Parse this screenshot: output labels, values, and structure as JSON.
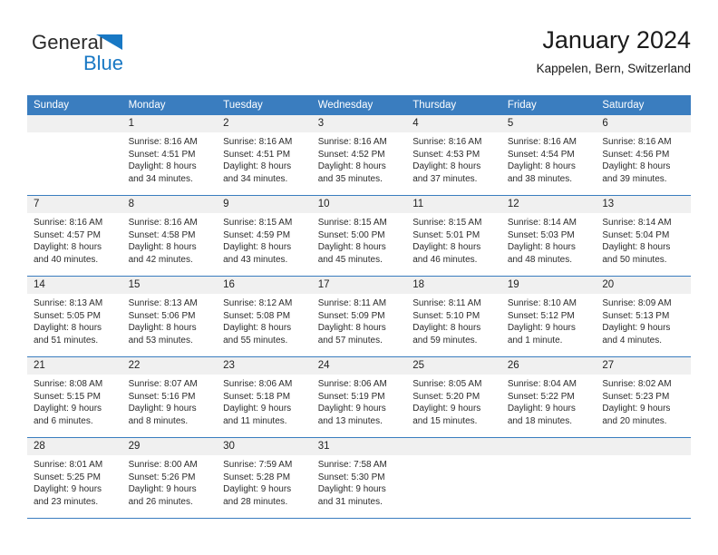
{
  "brand": {
    "name_top": "General",
    "name_bottom": "Blue",
    "accent_color": "#1878c4"
  },
  "header": {
    "title": "January 2024",
    "subtitle": "Kappelen, Bern, Switzerland"
  },
  "colors": {
    "header_row_bg": "#3a7dbf",
    "day_number_bg": "#f0f0f0",
    "text": "#222222",
    "page_bg": "#ffffff"
  },
  "weekday_headers": [
    "Sunday",
    "Monday",
    "Tuesday",
    "Wednesday",
    "Thursday",
    "Friday",
    "Saturday"
  ],
  "weeks": [
    [
      {
        "day": "",
        "sunrise": "",
        "sunset": "",
        "daylight_line1": "",
        "daylight_line2": ""
      },
      {
        "day": "1",
        "sunrise": "Sunrise: 8:16 AM",
        "sunset": "Sunset: 4:51 PM",
        "daylight_line1": "Daylight: 8 hours",
        "daylight_line2": "and 34 minutes."
      },
      {
        "day": "2",
        "sunrise": "Sunrise: 8:16 AM",
        "sunset": "Sunset: 4:51 PM",
        "daylight_line1": "Daylight: 8 hours",
        "daylight_line2": "and 34 minutes."
      },
      {
        "day": "3",
        "sunrise": "Sunrise: 8:16 AM",
        "sunset": "Sunset: 4:52 PM",
        "daylight_line1": "Daylight: 8 hours",
        "daylight_line2": "and 35 minutes."
      },
      {
        "day": "4",
        "sunrise": "Sunrise: 8:16 AM",
        "sunset": "Sunset: 4:53 PM",
        "daylight_line1": "Daylight: 8 hours",
        "daylight_line2": "and 37 minutes."
      },
      {
        "day": "5",
        "sunrise": "Sunrise: 8:16 AM",
        "sunset": "Sunset: 4:54 PM",
        "daylight_line1": "Daylight: 8 hours",
        "daylight_line2": "and 38 minutes."
      },
      {
        "day": "6",
        "sunrise": "Sunrise: 8:16 AM",
        "sunset": "Sunset: 4:56 PM",
        "daylight_line1": "Daylight: 8 hours",
        "daylight_line2": "and 39 minutes."
      }
    ],
    [
      {
        "day": "7",
        "sunrise": "Sunrise: 8:16 AM",
        "sunset": "Sunset: 4:57 PM",
        "daylight_line1": "Daylight: 8 hours",
        "daylight_line2": "and 40 minutes."
      },
      {
        "day": "8",
        "sunrise": "Sunrise: 8:16 AM",
        "sunset": "Sunset: 4:58 PM",
        "daylight_line1": "Daylight: 8 hours",
        "daylight_line2": "and 42 minutes."
      },
      {
        "day": "9",
        "sunrise": "Sunrise: 8:15 AM",
        "sunset": "Sunset: 4:59 PM",
        "daylight_line1": "Daylight: 8 hours",
        "daylight_line2": "and 43 minutes."
      },
      {
        "day": "10",
        "sunrise": "Sunrise: 8:15 AM",
        "sunset": "Sunset: 5:00 PM",
        "daylight_line1": "Daylight: 8 hours",
        "daylight_line2": "and 45 minutes."
      },
      {
        "day": "11",
        "sunrise": "Sunrise: 8:15 AM",
        "sunset": "Sunset: 5:01 PM",
        "daylight_line1": "Daylight: 8 hours",
        "daylight_line2": "and 46 minutes."
      },
      {
        "day": "12",
        "sunrise": "Sunrise: 8:14 AM",
        "sunset": "Sunset: 5:03 PM",
        "daylight_line1": "Daylight: 8 hours",
        "daylight_line2": "and 48 minutes."
      },
      {
        "day": "13",
        "sunrise": "Sunrise: 8:14 AM",
        "sunset": "Sunset: 5:04 PM",
        "daylight_line1": "Daylight: 8 hours",
        "daylight_line2": "and 50 minutes."
      }
    ],
    [
      {
        "day": "14",
        "sunrise": "Sunrise: 8:13 AM",
        "sunset": "Sunset: 5:05 PM",
        "daylight_line1": "Daylight: 8 hours",
        "daylight_line2": "and 51 minutes."
      },
      {
        "day": "15",
        "sunrise": "Sunrise: 8:13 AM",
        "sunset": "Sunset: 5:06 PM",
        "daylight_line1": "Daylight: 8 hours",
        "daylight_line2": "and 53 minutes."
      },
      {
        "day": "16",
        "sunrise": "Sunrise: 8:12 AM",
        "sunset": "Sunset: 5:08 PM",
        "daylight_line1": "Daylight: 8 hours",
        "daylight_line2": "and 55 minutes."
      },
      {
        "day": "17",
        "sunrise": "Sunrise: 8:11 AM",
        "sunset": "Sunset: 5:09 PM",
        "daylight_line1": "Daylight: 8 hours",
        "daylight_line2": "and 57 minutes."
      },
      {
        "day": "18",
        "sunrise": "Sunrise: 8:11 AM",
        "sunset": "Sunset: 5:10 PM",
        "daylight_line1": "Daylight: 8 hours",
        "daylight_line2": "and 59 minutes."
      },
      {
        "day": "19",
        "sunrise": "Sunrise: 8:10 AM",
        "sunset": "Sunset: 5:12 PM",
        "daylight_line1": "Daylight: 9 hours",
        "daylight_line2": "and 1 minute."
      },
      {
        "day": "20",
        "sunrise": "Sunrise: 8:09 AM",
        "sunset": "Sunset: 5:13 PM",
        "daylight_line1": "Daylight: 9 hours",
        "daylight_line2": "and 4 minutes."
      }
    ],
    [
      {
        "day": "21",
        "sunrise": "Sunrise: 8:08 AM",
        "sunset": "Sunset: 5:15 PM",
        "daylight_line1": "Daylight: 9 hours",
        "daylight_line2": "and 6 minutes."
      },
      {
        "day": "22",
        "sunrise": "Sunrise: 8:07 AM",
        "sunset": "Sunset: 5:16 PM",
        "daylight_line1": "Daylight: 9 hours",
        "daylight_line2": "and 8 minutes."
      },
      {
        "day": "23",
        "sunrise": "Sunrise: 8:06 AM",
        "sunset": "Sunset: 5:18 PM",
        "daylight_line1": "Daylight: 9 hours",
        "daylight_line2": "and 11 minutes."
      },
      {
        "day": "24",
        "sunrise": "Sunrise: 8:06 AM",
        "sunset": "Sunset: 5:19 PM",
        "daylight_line1": "Daylight: 9 hours",
        "daylight_line2": "and 13 minutes."
      },
      {
        "day": "25",
        "sunrise": "Sunrise: 8:05 AM",
        "sunset": "Sunset: 5:20 PM",
        "daylight_line1": "Daylight: 9 hours",
        "daylight_line2": "and 15 minutes."
      },
      {
        "day": "26",
        "sunrise": "Sunrise: 8:04 AM",
        "sunset": "Sunset: 5:22 PM",
        "daylight_line1": "Daylight: 9 hours",
        "daylight_line2": "and 18 minutes."
      },
      {
        "day": "27",
        "sunrise": "Sunrise: 8:02 AM",
        "sunset": "Sunset: 5:23 PM",
        "daylight_line1": "Daylight: 9 hours",
        "daylight_line2": "and 20 minutes."
      }
    ],
    [
      {
        "day": "28",
        "sunrise": "Sunrise: 8:01 AM",
        "sunset": "Sunset: 5:25 PM",
        "daylight_line1": "Daylight: 9 hours",
        "daylight_line2": "and 23 minutes."
      },
      {
        "day": "29",
        "sunrise": "Sunrise: 8:00 AM",
        "sunset": "Sunset: 5:26 PM",
        "daylight_line1": "Daylight: 9 hours",
        "daylight_line2": "and 26 minutes."
      },
      {
        "day": "30",
        "sunrise": "Sunrise: 7:59 AM",
        "sunset": "Sunset: 5:28 PM",
        "daylight_line1": "Daylight: 9 hours",
        "daylight_line2": "and 28 minutes."
      },
      {
        "day": "31",
        "sunrise": "Sunrise: 7:58 AM",
        "sunset": "Sunset: 5:30 PM",
        "daylight_line1": "Daylight: 9 hours",
        "daylight_line2": "and 31 minutes."
      },
      {
        "day": "",
        "sunrise": "",
        "sunset": "",
        "daylight_line1": "",
        "daylight_line2": ""
      },
      {
        "day": "",
        "sunrise": "",
        "sunset": "",
        "daylight_line1": "",
        "daylight_line2": ""
      },
      {
        "day": "",
        "sunrise": "",
        "sunset": "",
        "daylight_line1": "",
        "daylight_line2": ""
      }
    ]
  ]
}
